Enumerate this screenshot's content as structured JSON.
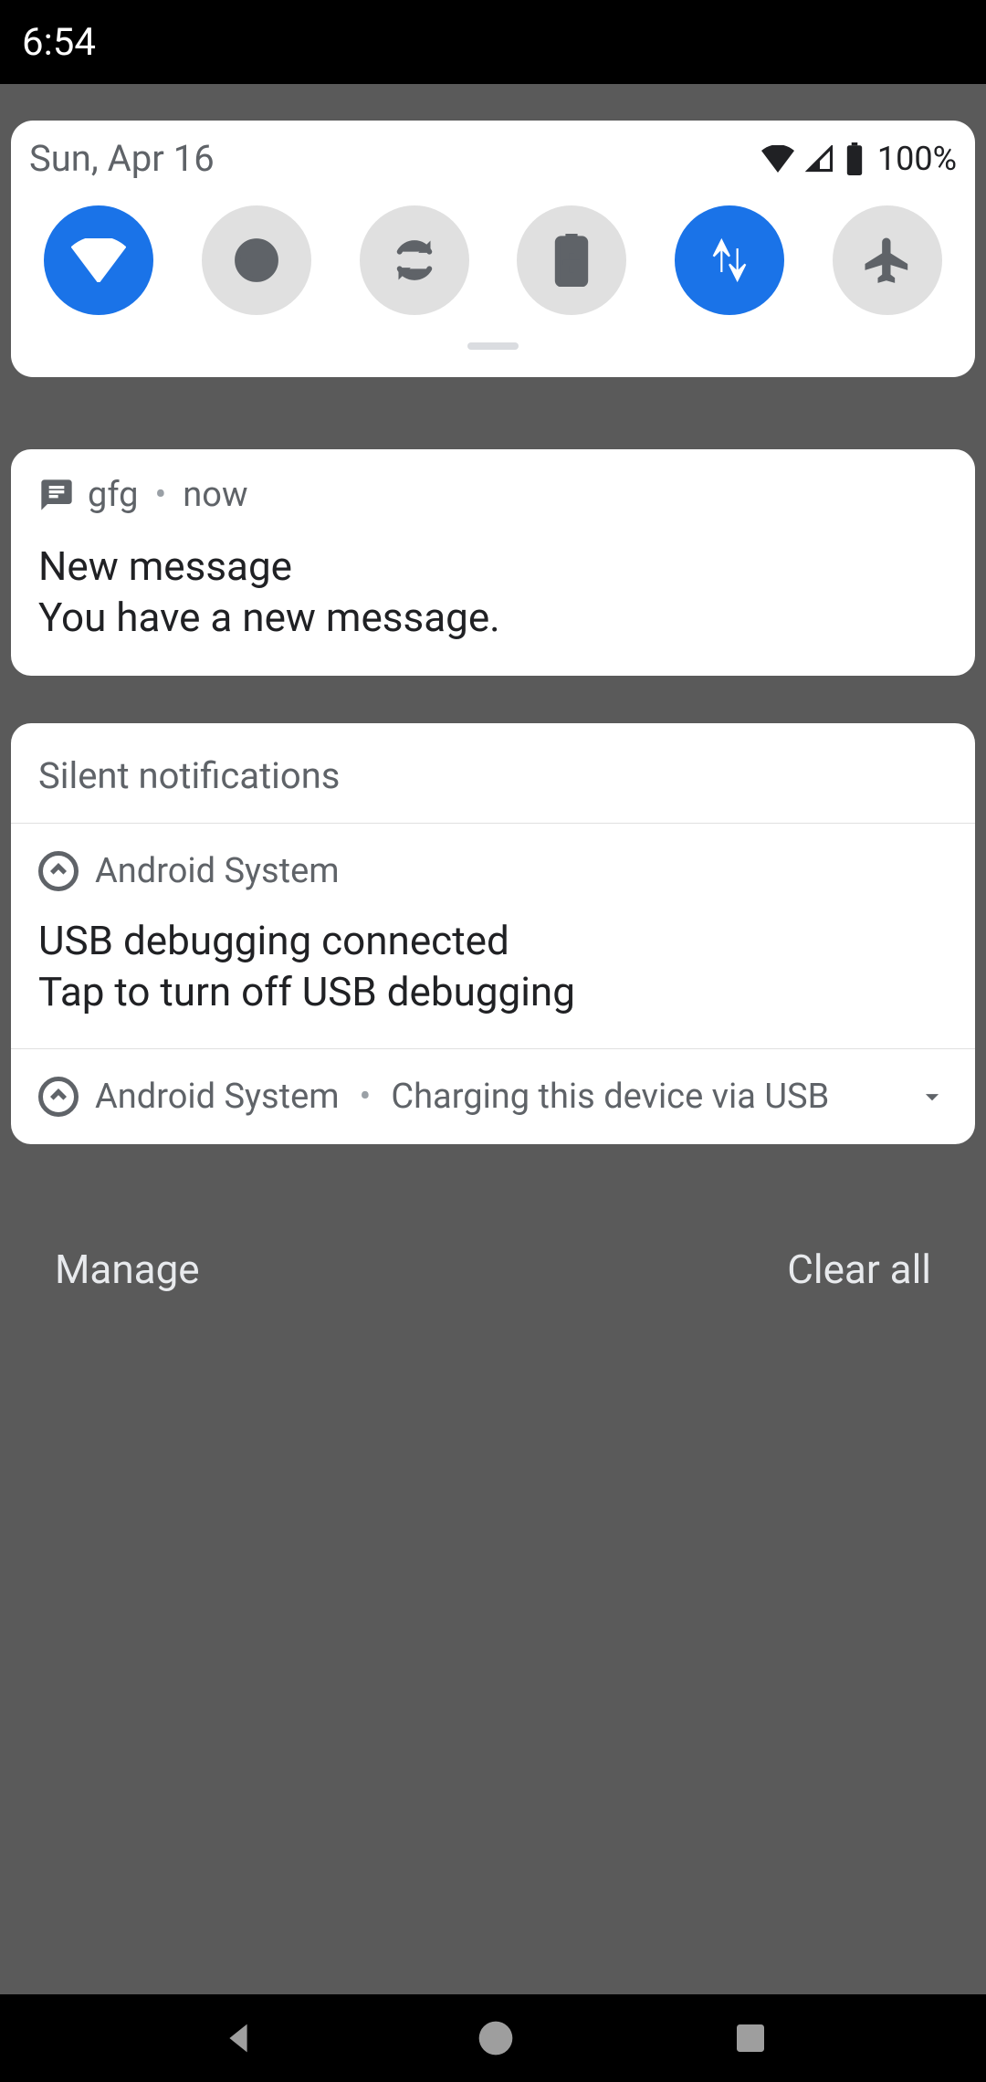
{
  "status_bar": {
    "time": "6:54"
  },
  "qs": {
    "date": "Sun, Apr 16",
    "battery_pct": "100%",
    "tiles": [
      {
        "name": "wifi",
        "on": true
      },
      {
        "name": "dnd",
        "on": false
      },
      {
        "name": "autorotate",
        "on": false
      },
      {
        "name": "battery-saver",
        "on": false
      },
      {
        "name": "mobile-data",
        "on": true
      },
      {
        "name": "airplane",
        "on": false
      }
    ]
  },
  "notifications": {
    "message": {
      "app": "gfg",
      "when": "now",
      "title": "New message",
      "body": "You have a new message."
    }
  },
  "silent": {
    "header": "Silent notifications",
    "usb": {
      "app": "Android System",
      "title": "USB debugging connected",
      "body": "Tap to turn off USB debugging"
    },
    "charging": {
      "app": "Android System",
      "summary": "Charging this device via USB"
    }
  },
  "actions": {
    "manage": "Manage",
    "clear_all": "Clear all"
  }
}
